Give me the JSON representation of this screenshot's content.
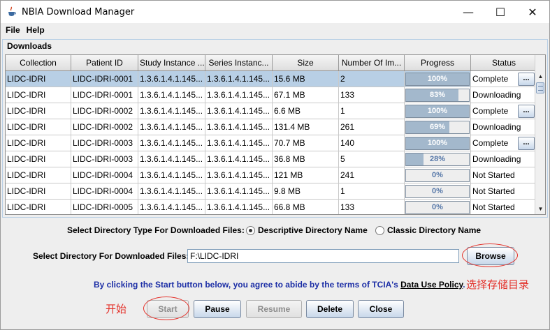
{
  "window": {
    "title": "NBIA Download Manager",
    "controls": {
      "minimize": "—",
      "maximize": "☐",
      "close": "✕"
    }
  },
  "menu": [
    "File",
    "Help"
  ],
  "downloads": {
    "title": "Downloads",
    "columns": [
      "Collection",
      "Patient ID",
      "Study Instance ...",
      "Series Instanc...",
      "Size",
      "Number Of Im...",
      "Progress",
      "Status"
    ],
    "rows": [
      {
        "collection": "LIDC-IDRI",
        "patient_id": "LIDC-IDRI-0001",
        "study": "1.3.6.1.4.1.145...",
        "series": "1.3.6.1.4.1.145...",
        "size": "15.6 MB",
        "images": "2",
        "progress": 100,
        "progress_label": "100%",
        "status": "Complete",
        "has_action": true,
        "selected": true
      },
      {
        "collection": "LIDC-IDRI",
        "patient_id": "LIDC-IDRI-0001",
        "study": "1.3.6.1.4.1.145...",
        "series": "1.3.6.1.4.1.145...",
        "size": "67.1 MB",
        "images": "133",
        "progress": 83,
        "progress_label": "83%",
        "status": "Downloading",
        "has_action": false,
        "selected": false
      },
      {
        "collection": "LIDC-IDRI",
        "patient_id": "LIDC-IDRI-0002",
        "study": "1.3.6.1.4.1.145...",
        "series": "1.3.6.1.4.1.145...",
        "size": "6.6 MB",
        "images": "1",
        "progress": 100,
        "progress_label": "100%",
        "status": "Complete",
        "has_action": true,
        "selected": false
      },
      {
        "collection": "LIDC-IDRI",
        "patient_id": "LIDC-IDRI-0002",
        "study": "1.3.6.1.4.1.145...",
        "series": "1.3.6.1.4.1.145...",
        "size": "131.4 MB",
        "images": "261",
        "progress": 69,
        "progress_label": "69%",
        "status": "Downloading",
        "has_action": false,
        "selected": false
      },
      {
        "collection": "LIDC-IDRI",
        "patient_id": "LIDC-IDRI-0003",
        "study": "1.3.6.1.4.1.145...",
        "series": "1.3.6.1.4.1.145...",
        "size": "70.7 MB",
        "images": "140",
        "progress": 100,
        "progress_label": "100%",
        "status": "Complete",
        "has_action": true,
        "selected": false
      },
      {
        "collection": "LIDC-IDRI",
        "patient_id": "LIDC-IDRI-0003",
        "study": "1.3.6.1.4.1.145...",
        "series": "1.3.6.1.4.1.145...",
        "size": "36.8 MB",
        "images": "5",
        "progress": 28,
        "progress_label": "28%",
        "status": "Downloading",
        "has_action": false,
        "selected": false
      },
      {
        "collection": "LIDC-IDRI",
        "patient_id": "LIDC-IDRI-0004",
        "study": "1.3.6.1.4.1.145...",
        "series": "1.3.6.1.4.1.145...",
        "size": "121 MB",
        "images": "241",
        "progress": 0,
        "progress_label": "0%",
        "status": "Not Started",
        "has_action": false,
        "selected": false
      },
      {
        "collection": "LIDC-IDRI",
        "patient_id": "LIDC-IDRI-0004",
        "study": "1.3.6.1.4.1.145...",
        "series": "1.3.6.1.4.1.145...",
        "size": "9.8 MB",
        "images": "1",
        "progress": 0,
        "progress_label": "0%",
        "status": "Not Started",
        "has_action": false,
        "selected": false
      },
      {
        "collection": "LIDC-IDRI",
        "patient_id": "LIDC-IDRI-0005",
        "study": "1.3.6.1.4.1.145...",
        "series": "1.3.6.1.4.1.145...",
        "size": "66.8 MB",
        "images": "133",
        "progress": 0,
        "progress_label": "0%",
        "status": "Not Started",
        "has_action": false,
        "selected": false
      }
    ],
    "action_label": "..."
  },
  "directory_type": {
    "label": "Select Directory Type For Downloaded Files:",
    "options": [
      "Descriptive Directory Name",
      "Classic Directory Name"
    ],
    "selected": "Descriptive Directory Name"
  },
  "directory": {
    "label": "Select Directory For Downloaded Files:",
    "value": "F:\\LIDC-IDRI",
    "browse": "Browse"
  },
  "agreement": {
    "text": "By clicking the Start button below, you agree to abide by the terms of TCIA's ",
    "link": "Data Use Policy",
    "suffix": "."
  },
  "buttons": {
    "start": "Start",
    "pause": "Pause",
    "resume": "Resume",
    "delete": "Delete",
    "close": "Close"
  },
  "annotations": {
    "browse_note": "选择存储目录",
    "start_note": "开始"
  },
  "colors": {
    "selection": "#b8cfe5",
    "progress_fill": "#a3b8cc",
    "annotation": "#e4322b",
    "agreement_text": "#1d2fa6"
  }
}
